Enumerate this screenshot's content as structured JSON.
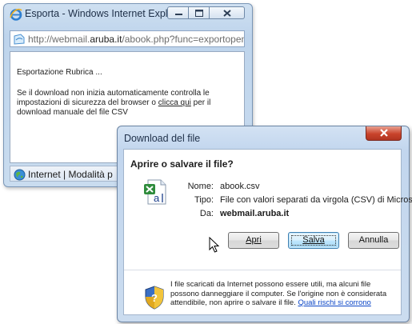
{
  "ie_window": {
    "title": "Esporta - Windows Internet Explorer",
    "address": {
      "url_prefix": "http://webmail.",
      "url_domain": "aruba.it",
      "url_suffix": "/abook.php?func=exportopen"
    },
    "content": {
      "heading": "Esportazione Rubrica ...",
      "text_before_link": "Se il download non inizia automaticamente controlla le impostazioni di sicurezza del browser o ",
      "link": "clicca qui",
      "text_after_link": " per il download manuale del file CSV"
    },
    "status": "Internet | Modalità p"
  },
  "dialog": {
    "title": "Download del file",
    "question": "Aprire o salvare il file?",
    "fields": [
      {
        "label": "Nome:",
        "value": "abook.csv"
      },
      {
        "label": "Tipo:",
        "value": "File con valori separati da virgola (CSV) di Micros..."
      },
      {
        "label": "Da:",
        "value": "webmail.aruba.it"
      }
    ],
    "buttons": {
      "open": "Apri",
      "save": "Salva",
      "cancel": "Annulla"
    },
    "warning": {
      "text": "I file scaricati da Internet possono essere utili, ma alcuni file possono danneggiare il computer. Se l'origine non è considerata attendibile, non aprire o salvare il file. ",
      "link": "Quali rischi si corrono"
    }
  },
  "icons": [
    "ie-logo-icon",
    "minimize-icon",
    "maximize-icon",
    "close-icon",
    "page-icon",
    "globe-icon",
    "csv-file-icon",
    "shield-icon",
    "mouse-cursor-icon"
  ],
  "colors": {
    "accent": "#3c7fb1",
    "link": "#0a45c6",
    "close_red": "#c9432b"
  }
}
